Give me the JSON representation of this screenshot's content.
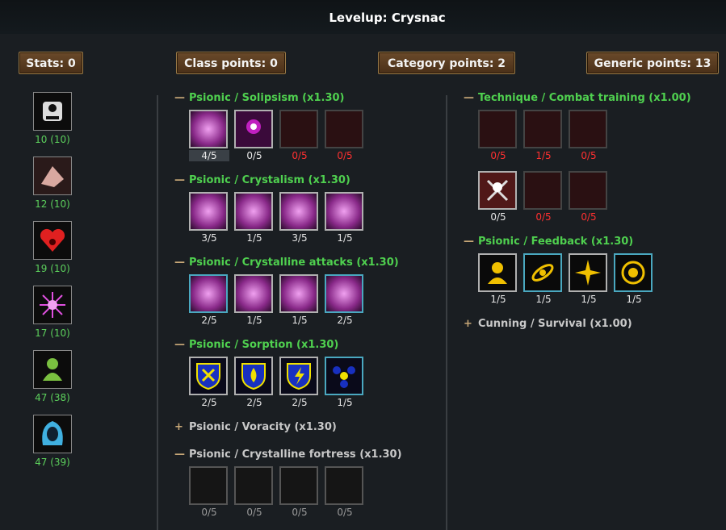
{
  "window": {
    "title": "Levelup: Crysnac"
  },
  "headers": {
    "stats": "Stats: 0",
    "class_points": "Class points: 0",
    "category_points": "Category points: 2",
    "generic_points": "Generic points: 13"
  },
  "stats": [
    {
      "icon": "strength-icon",
      "value": "10 (10)"
    },
    {
      "icon": "dexterity-icon",
      "value": "12 (10)"
    },
    {
      "icon": "constitution-icon",
      "value": "19 (10)"
    },
    {
      "icon": "magic-icon",
      "value": "17 (10)"
    },
    {
      "icon": "willpower-icon",
      "value": "47 (38)"
    },
    {
      "icon": "cunning-icon",
      "value": "47 (39)"
    }
  ],
  "class_trees": [
    {
      "label": "Psionic / Solipsism (x1.30)",
      "expanded": true,
      "counts": [
        "4/5",
        "0/5",
        "0/5",
        "0/5"
      ]
    },
    {
      "label": "Psionic / Crystalism (x1.30)",
      "expanded": true,
      "counts": [
        "3/5",
        "1/5",
        "3/5",
        "1/5"
      ]
    },
    {
      "label": "Psionic / Crystalline attacks (x1.30)",
      "expanded": true,
      "counts": [
        "2/5",
        "1/5",
        "1/5",
        "2/5"
      ]
    },
    {
      "label": "Psionic / Sorption (x1.30)",
      "expanded": true,
      "counts": [
        "2/5",
        "2/5",
        "2/5",
        "1/5"
      ]
    },
    {
      "label": "Psionic / Voracity (x1.30)",
      "expanded": false
    },
    {
      "label": "Psionic / Crystalline fortress (x1.30)",
      "expanded": true,
      "counts": [
        "0/5",
        "0/5",
        "0/5",
        "0/5"
      ]
    }
  ],
  "generic_trees": [
    {
      "label": "Technique / Combat training (x1.00)",
      "expanded": true,
      "counts": [
        "0/5",
        "1/5",
        "0/5",
        "0/5",
        "0/5",
        "0/5"
      ]
    },
    {
      "label": "Psionic / Feedback (x1.30)",
      "expanded": true,
      "counts": [
        "1/5",
        "1/5",
        "1/5",
        "1/5"
      ]
    },
    {
      "label": "Cunning / Survival (x1.00)",
      "expanded": false
    }
  ],
  "colors": {
    "green": "#4fd04f",
    "red": "#ff3030",
    "gold": "#9a7a48"
  }
}
